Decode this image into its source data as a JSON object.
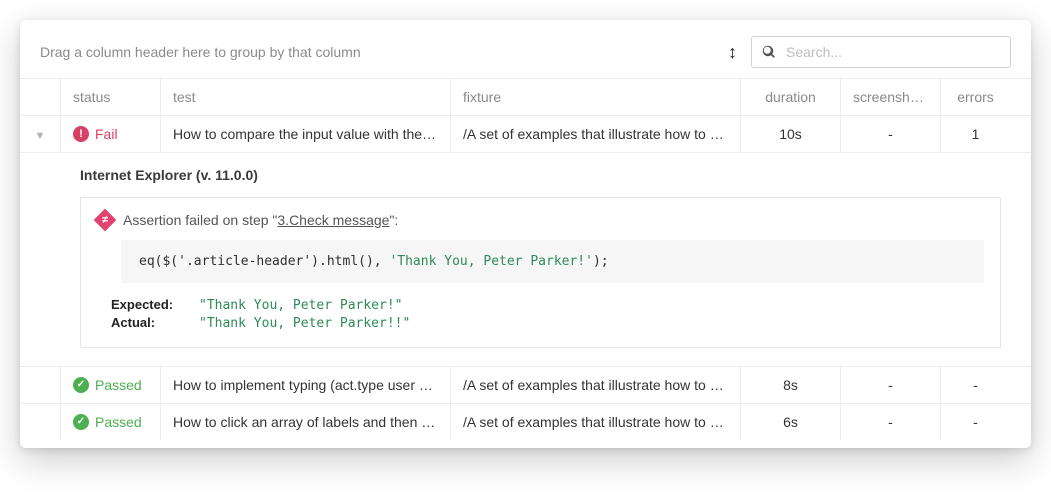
{
  "topbar": {
    "group_hint": "Drag a column header here to group by that column",
    "search_placeholder": "Search..."
  },
  "columns": {
    "status": "status",
    "test": "test",
    "fixture": "fixture",
    "duration": "duration",
    "screenshots": "screenshots",
    "errors": "errors"
  },
  "rows": [
    {
      "status_kind": "fail",
      "status_label": "Fail",
      "test": "How to compare the input value with the s...",
      "fixture": "/A set of examples that illustrate how to us...",
      "duration": "10s",
      "screenshots": "-",
      "errors": "1"
    },
    {
      "status_kind": "pass",
      "status_label": "Passed",
      "test": "How to implement typing (act.type user act...",
      "fixture": "/A set of examples that illustrate how to us...",
      "duration": "8s",
      "screenshots": "-",
      "errors": "-"
    },
    {
      "status_kind": "pass",
      "status_label": "Passed",
      "test": "How to click an array of labels and then che...",
      "fixture": "/A set of examples that illustrate how to us...",
      "duration": "6s",
      "screenshots": "-",
      "errors": "-"
    }
  ],
  "detail": {
    "browser": "Internet Explorer (v. 11.0.0)",
    "assert_prefix": "Assertion failed on step \"",
    "assert_step": "3.Check message",
    "assert_suffix": "\":",
    "code_pre": "eq($('.article-header').html(), ",
    "code_str": "'Thank You, Peter Parker!'",
    "code_post": ");",
    "expected_label": "Expected:",
    "expected_value": "\"Thank You, Peter Parker!\"",
    "actual_label": "Actual:",
    "actual_value": "\"Thank You, Peter Parker!!\""
  }
}
